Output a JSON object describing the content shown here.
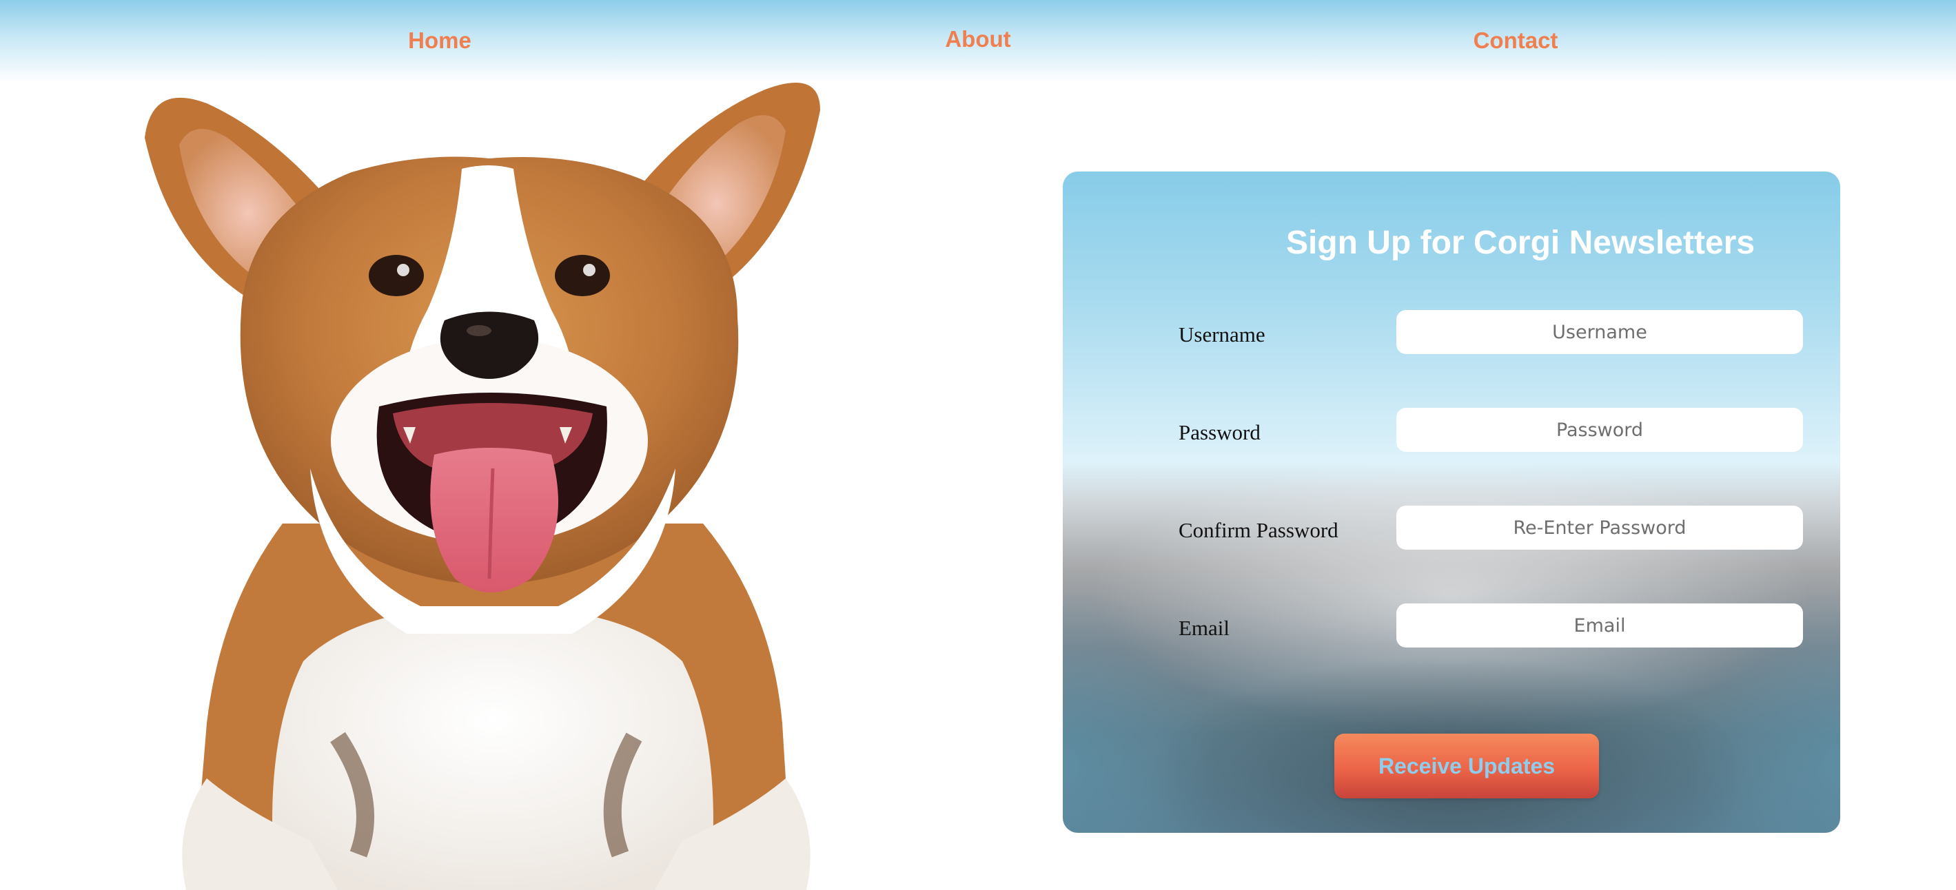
{
  "nav": {
    "home": "Home",
    "about": "About",
    "contact": "Contact"
  },
  "signup": {
    "title": "Sign Up for Corgi Newsletters",
    "fields": {
      "username": {
        "label": "Username",
        "placeholder": "Username",
        "value": ""
      },
      "password": {
        "label": "Password",
        "placeholder": "Password",
        "value": ""
      },
      "confirm": {
        "label": "Confirm Password",
        "placeholder": "Re-Enter Password",
        "value": ""
      },
      "email": {
        "label": "Email",
        "placeholder": "Email",
        "value": ""
      }
    },
    "submit_label": "Receive Updates"
  },
  "colors": {
    "accent": "#f07f4f",
    "nav_bg": "#8ecde9",
    "button": "#eb6448",
    "button_text": "#8ecdec"
  }
}
